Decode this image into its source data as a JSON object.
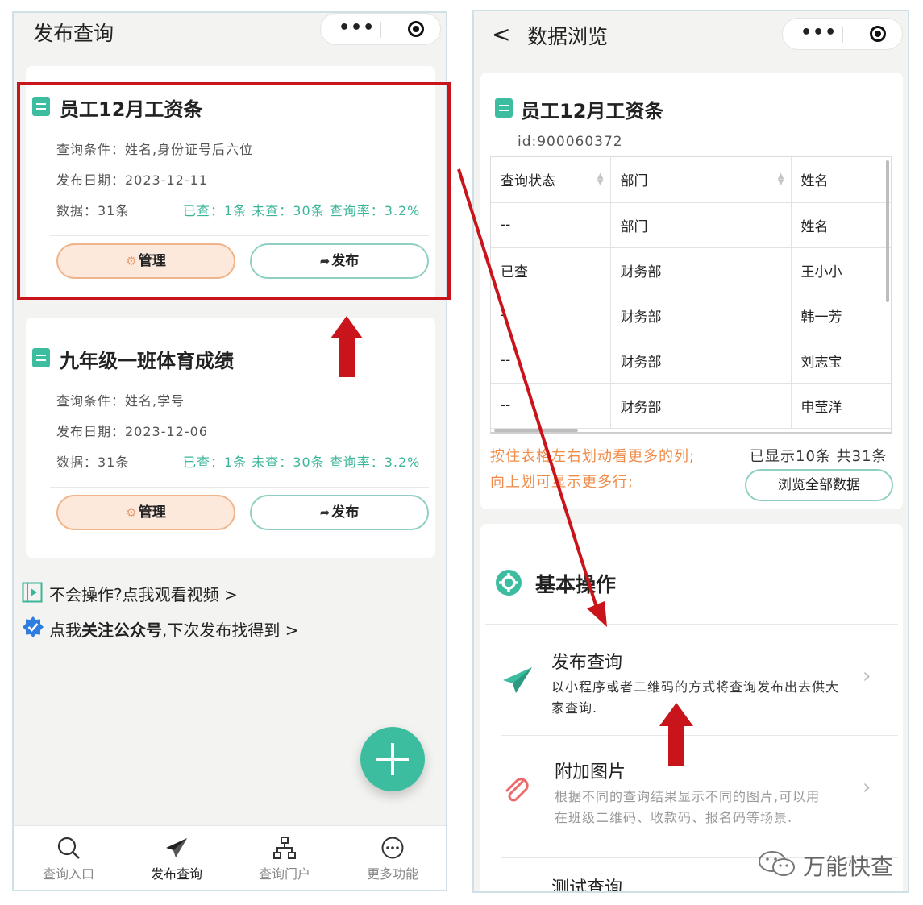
{
  "left": {
    "nav_title": "发布查询",
    "capsule_more": "•••",
    "cards": [
      {
        "title": "员工12月工资条",
        "conditions": "查询条件：姓名,身份证号后六位",
        "date": "发布日期：2023-12-11",
        "data": "数据：31条",
        "stats": "已查：1条 未查：30条 查询率：3.2%",
        "manage_label": "管理",
        "publish_label": "发布"
      },
      {
        "title": "九年级一班体育成绩",
        "conditions": "查询条件：姓名,学号",
        "date": "发布日期：2023-12-06",
        "data": "数据：31条",
        "stats": "已查：1条 未查：30条 查询率：3.2%",
        "manage_label": "管理",
        "publish_label": "发布"
      }
    ],
    "helper_video": "不会操作?点我观看视频 >",
    "helper_follow_prefix": "点我",
    "helper_follow_bold": "关注公众号",
    "helper_follow_suffix": ",下次发布找得到 >",
    "tabs": [
      {
        "label": "查询入口",
        "icon": "search-icon"
      },
      {
        "label": "发布查询",
        "icon": "paper-plane-icon"
      },
      {
        "label": "查询门户",
        "icon": "sitemap-icon"
      },
      {
        "label": "更多功能",
        "icon": "more-circle-icon"
      }
    ]
  },
  "right": {
    "nav_back": "<",
    "nav_title": "数据浏览",
    "capsule_more": "•••",
    "sheet_title": "员工12月工资条",
    "sheet_id": "id:900060372",
    "table": {
      "headers": [
        "查询状态",
        "部门",
        "姓名"
      ],
      "rows": [
        [
          "--",
          "部门",
          "姓名"
        ],
        [
          "已查",
          "财务部",
          "王小小"
        ],
        [
          "-",
          "财务部",
          "韩一芳"
        ],
        [
          "--",
          "财务部",
          "刘志宝"
        ],
        [
          "--",
          "财务部",
          "申莹洋"
        ]
      ]
    },
    "hint_line1": "按住表格左右划动看更多的列;",
    "hint_line2": "向上划可显示更多行;",
    "shown_count": "已显示10条 共31条",
    "browse_all_label": "浏览全部数据",
    "section_title": "基本操作",
    "actions": [
      {
        "title": "发布查询",
        "desc": "以小程序或者二维码的方式将查询发布出去供大家查询.",
        "icon": "paper-plane-icon"
      },
      {
        "title": "附加图片",
        "desc": "根据不同的查询结果显示不同的图片,可以用在班级二维码、收款码、报名码等场景.",
        "icon": "paperclip-icon"
      },
      {
        "title": "测试查询",
        "desc": "",
        "icon": "test-icon"
      }
    ]
  },
  "watermark": "万能快查",
  "colors": {
    "accent": "#3dbd9f",
    "highlight_red": "#c8141a",
    "manage_bg": "#fde9dc",
    "hint_orange": "#f08c4a"
  }
}
